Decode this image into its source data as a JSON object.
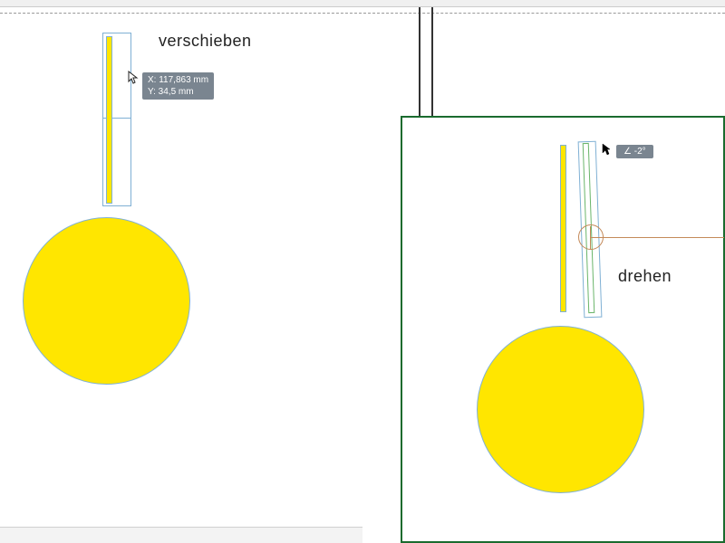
{
  "labels": {
    "move": "verschieben",
    "rotate": "drehen"
  },
  "tooltips": {
    "move_x": "X: 117,863 mm",
    "move_y": "Y: 34,5 mm",
    "rotate_angle": "∠  -2°"
  },
  "colors": {
    "yellow": "#ffe600",
    "selection": "#7fb0d4",
    "panel_border": "#1a6b2e",
    "tooltip_bg": "#7a8590",
    "rotation_guide": "#c48a5a"
  }
}
